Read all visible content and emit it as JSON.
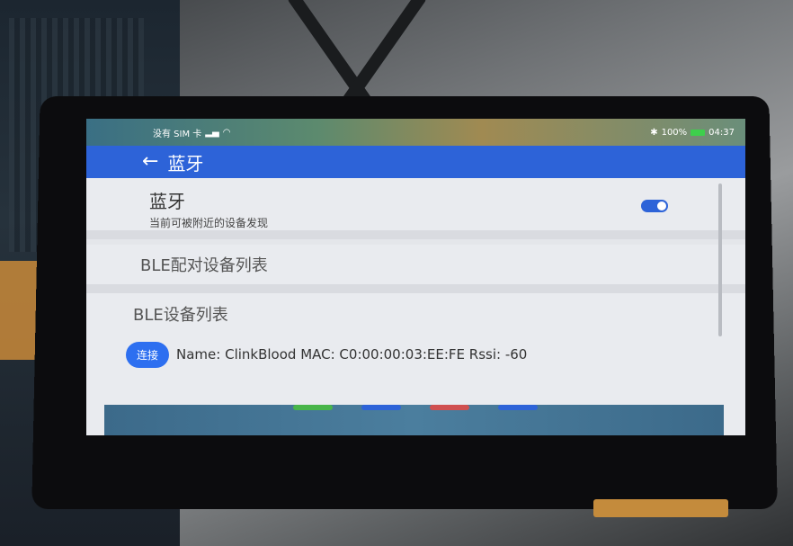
{
  "status_bar": {
    "left_text": "没有 SIM 卡",
    "signal_icon": "signal-icon",
    "wifi_icon": "wifi-icon",
    "battery_text": "100%",
    "time": "04:37"
  },
  "app_bar": {
    "back_icon": "arrow-left-icon",
    "title": "蓝牙"
  },
  "bluetooth_row": {
    "title": "蓝牙",
    "subtitle": "当前可被附近的设备发现",
    "toggle_on": true
  },
  "sections": {
    "paired_title": "BLE配对设备列表",
    "list_title": "BLE设备列表"
  },
  "device": {
    "connect_label": "连接",
    "info": "Name: ClinkBlood MAC: C0:00:00:03:EE:FE Rssi: -60"
  },
  "colors": {
    "app_bar": "#2d63d8",
    "button": "#2d6ff0",
    "screen_bg": "#e9ebef"
  }
}
